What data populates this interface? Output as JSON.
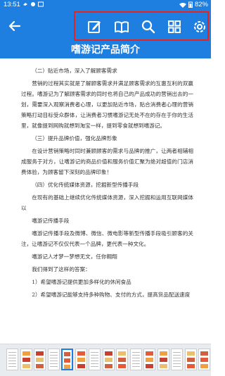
{
  "status_bar": {
    "time": "13:51",
    "battery": "82%",
    "icons": [
      "bird-icon",
      "notification-icon",
      "image-icon",
      "wifi-icon",
      "battery-icon"
    ]
  },
  "toolbar": {
    "buttons": [
      "back-icon",
      "edit-icon",
      "book-icon",
      "search-icon",
      "grid-icon",
      "settings-icon"
    ]
  },
  "document": {
    "title": "嗜游记产品简介",
    "paragraphs": [
      "（二）贴近市场，深入了解顾客需求",
      "营销的过程其实就是了解顾客需求并满足顾客需求的互惠互利的双赢过程。嗜游记为了解顾客需求的同时也将自己的产品成功的营销出去的一划，需要深入观察消费者心理，以更加贴近市场，贴合消费者心理的营销策略打动目标受众群体，让消费者习惯嗜游记无处不在的存在于你的生活里，就像提到网购就想到淘宝一样，提到零食就想到嗜游记。",
      "（三）提升品牌价值，强化品牌形象",
      "在设计营销策略时同时兼顾顾客的需求与品牌的推广，让两者相辅相成服务于对方，让嗜游记的商品价值和服务价值汇聚为绝对超值的门店消费体验，为顾客留下深刻的品牌印象！",
      "（四）优化传统媒体资源，挖掘新型传播手段",
      "在现有的基础上继续优化传统媒体资源，深入挖掘和运用互联网媒体以",
      "嗜游记传播手段",
      "嗜游记传播手段及微博、微信、微电影等新型传播手段吸引顾客的关注，让嗜游记不仅仅代表一个品牌，更代表一种文化。",
      "嗜游记人才梦一梦想无文，任你翱翔",
      "我们得到了这样的答案：",
      "1）希望嗜游记提供更加多样化的休闲食品",
      "2）希望嗜游记能够支持多种购物、支付的方式，提高货品配送速度"
    ]
  },
  "thumbnails": {
    "count": 15,
    "active_index": 4
  },
  "colors": {
    "primary": "#1e7fe0",
    "highlight_border": "#e8231d",
    "thumb_bg": "#e9ecef"
  }
}
